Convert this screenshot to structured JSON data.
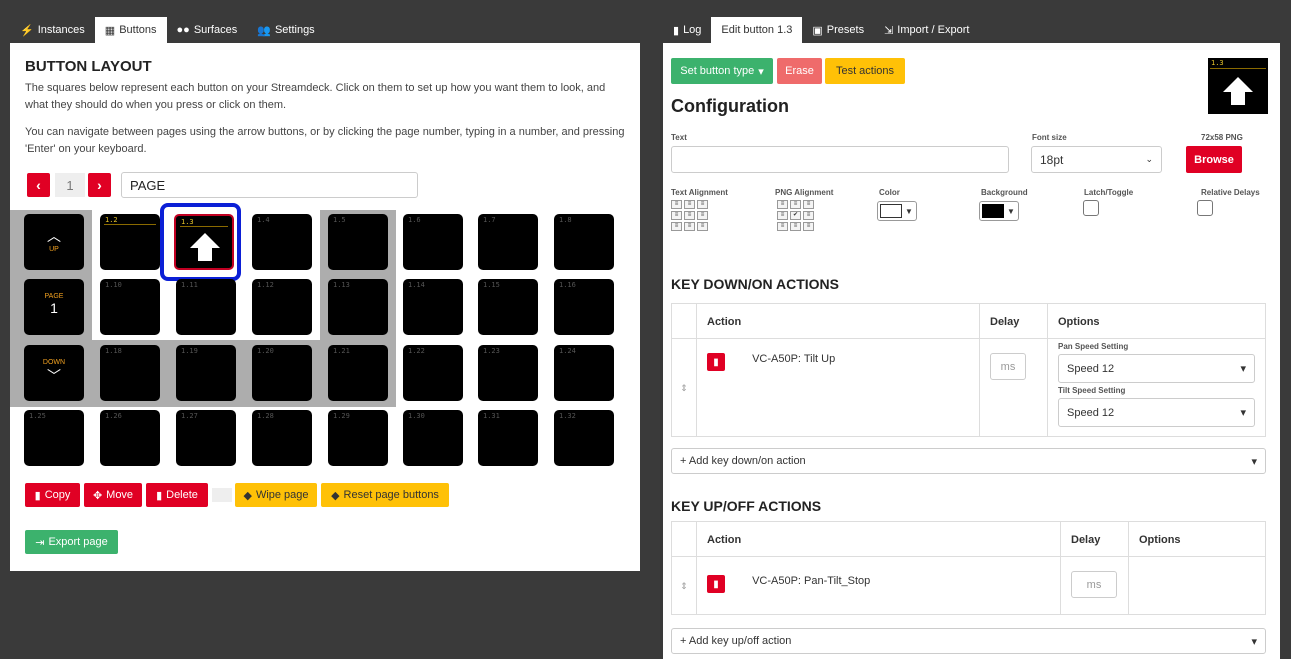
{
  "left_tabs": [
    {
      "label": "Instances",
      "icon": "plug-icon"
    },
    {
      "label": "Buttons",
      "icon": "grid-icon"
    },
    {
      "label": "Surfaces",
      "icon": "gamepad-icon"
    },
    {
      "label": "Settings",
      "icon": "users-icon"
    }
  ],
  "button_layout": {
    "title": "BUTTON LAYOUT",
    "desc1": "The squares below represent each button on your Streamdeck. Click on them to set up how you want them to look, and what they should do when you press or click on them.",
    "desc2": "You can navigate between pages using the arrow buttons, or by clicking the page number, typing in a number, and pressing 'Enter' on your keyboard.",
    "page_number": "1",
    "page_name": "PAGE",
    "nav_up": "UP",
    "nav_page": "PAGE",
    "nav_page_num": "1",
    "nav_down": "DOWN",
    "button_numbers": [
      "1.2",
      "1.3",
      "1.4",
      "1.5",
      "1.6",
      "1.7",
      "1.8",
      "1.10",
      "1.11",
      "1.12",
      "1.13",
      "1.14",
      "1.15",
      "1.16",
      "1.18",
      "1.19",
      "1.20",
      "1.21",
      "1.22",
      "1.23",
      "1.24",
      "1.25",
      "1.26",
      "1.27",
      "1.28",
      "1.29",
      "1.30",
      "1.31",
      "1.32"
    ],
    "copy": "Copy",
    "move": "Move",
    "delete": "Delete",
    "wipe": "Wipe page",
    "reset": "Reset page buttons",
    "export": "Export page"
  },
  "right_tabs": [
    {
      "label": "Log",
      "icon": "clipboard-icon"
    },
    {
      "label": "Edit button 1.3",
      "icon": ""
    },
    {
      "label": "Presets",
      "icon": "gift-icon"
    },
    {
      "label": "Import / Export",
      "icon": "import-icon"
    }
  ],
  "edit": {
    "set_type": "Set button type",
    "erase": "Erase",
    "test": "Test actions",
    "preview_num": "1.3",
    "config_title": "Configuration",
    "text_label": "Text",
    "text_value": "",
    "font_size_label": "Font size",
    "font_size_value": "18pt",
    "png_label": "72x58 PNG",
    "browse": "Browse",
    "text_align_label": "Text Alignment",
    "png_align_label": "PNG Alignment",
    "color_label": "Color",
    "bg_label": "Background",
    "latch_label": "Latch/Toggle",
    "relative_label": "Relative Delays",
    "color_value": "#ffffff",
    "bg_value": "#000000"
  },
  "key_down": {
    "title": "KEY DOWN/ON ACTIONS",
    "col_action": "Action",
    "col_delay": "Delay",
    "col_options": "Options",
    "action_name": "VC-A50P: Tilt Up",
    "delay_placeholder": "ms",
    "opt1_label": "Pan Speed Setting",
    "opt1_value": "Speed 12",
    "opt2_label": "Tilt Speed Setting",
    "opt2_value": "Speed 12",
    "add": "+ Add key down/on action"
  },
  "key_up": {
    "title": "KEY UP/OFF ACTIONS",
    "col_action": "Action",
    "col_delay": "Delay",
    "col_options": "Options",
    "action_name": "VC-A50P: Pan-Tilt_Stop",
    "delay_placeholder": "ms",
    "add": "+ Add key up/off action"
  }
}
